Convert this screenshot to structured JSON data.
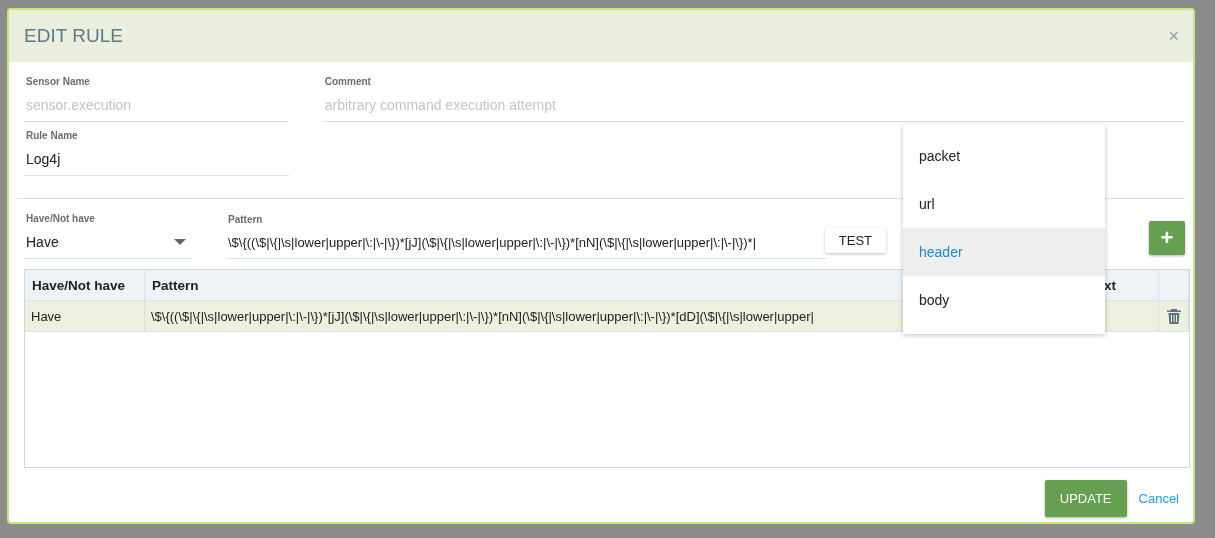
{
  "dialog": {
    "title": "EDIT RULE",
    "close": "×"
  },
  "sensor_name": {
    "label": "Sensor Name",
    "placeholder": "sensor.execution"
  },
  "comment": {
    "label": "Comment",
    "placeholder": "arbitrary command execution attempt"
  },
  "rule_name": {
    "label": "Rule Name",
    "value": "Log4j"
  },
  "have_select": {
    "label": "Have/Not have",
    "value": "Have"
  },
  "pattern": {
    "label": "Pattern",
    "value": "\\$\\{((\\$|\\{|\\s|lower|upper|\\:|\\-|\\})*[jJ](\\$|\\{|\\s|lower|upper|\\:|\\-|\\})*[nN](\\$|\\{|\\s|lower|upper|\\:|\\-|\\})*|"
  },
  "test_button": "TEST",
  "add_button": "+",
  "table": {
    "columns": [
      "Have/Not have",
      "Pattern",
      "xt"
    ],
    "rows": [
      {
        "have": "Have",
        "pattern": "\\$\\{((\\$|\\{|\\s|lower|upper|\\:|\\-|\\})*[jJ](\\$|\\{|\\s|lower|upper|\\:|\\-|\\})*[nN](\\$|\\{|\\s|lower|upper|\\:|\\-|\\})*[dD](\\$|\\{|\\s|lower|upper|"
      }
    ]
  },
  "dropdown": [
    {
      "label": "packet",
      "selected": false
    },
    {
      "label": "url",
      "selected": false
    },
    {
      "label": "header",
      "selected": true
    },
    {
      "label": "body",
      "selected": false
    }
  ],
  "buttons": {
    "update": "UPDATE",
    "cancel": "Cancel"
  }
}
